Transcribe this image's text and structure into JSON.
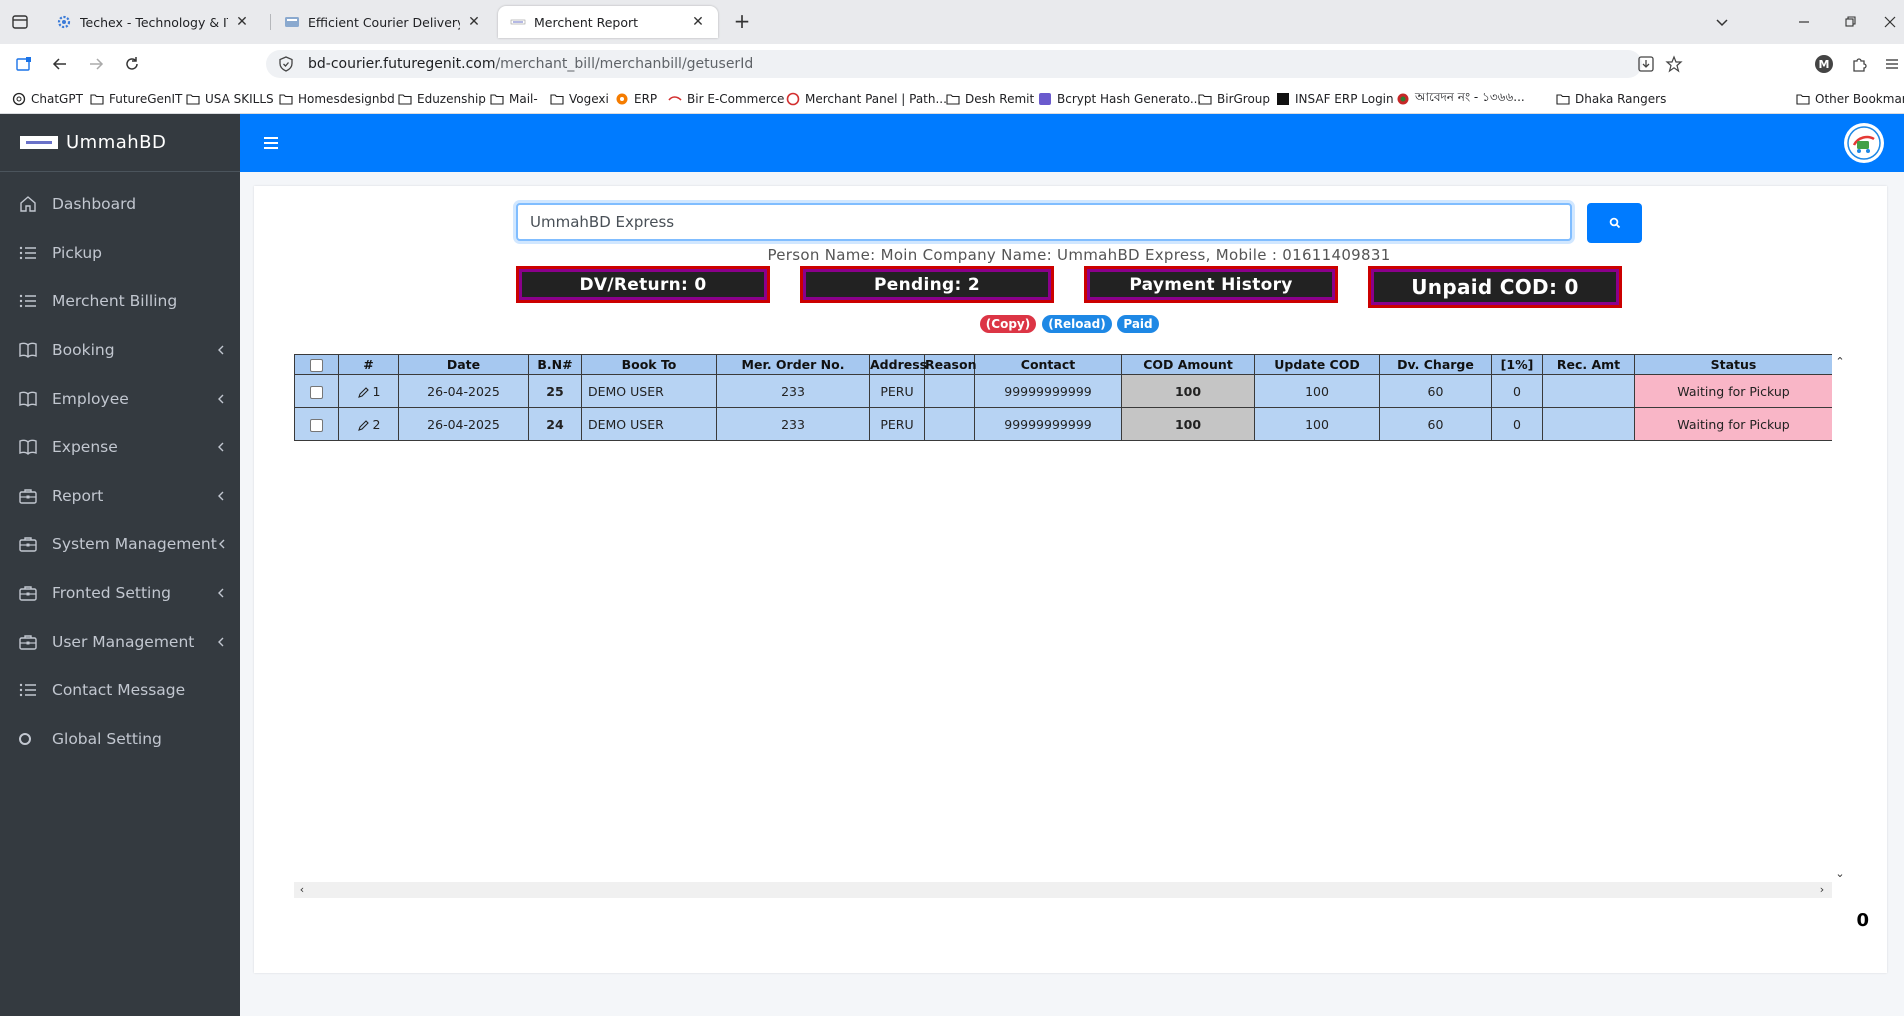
{
  "browser": {
    "tabs": [
      {
        "title": "Techex - Technology & IT Servic",
        "active": false
      },
      {
        "title": "Efficient Courier Delivery Manac",
        "active": false
      },
      {
        "title": "Merchent Report",
        "active": true
      }
    ],
    "url_host": "bd-courier.futuregenit.com",
    "url_path": "/merchant_bill/merchanbill/getuserId",
    "bookmarks": [
      "ChatGPT",
      "FutureGenIT",
      "USA SKILLS",
      "Homesdesignbd",
      "Eduzenship",
      "Mail-",
      "Vogexi",
      "ERP",
      "Bir E-Commerce",
      "Merchant Panel | Path...",
      "Desh Remit",
      "Bcrypt Hash Generato...",
      "BirGroup",
      "INSAF ERP Login",
      "আবেদন নং - ১৩৬৬...",
      "Dhaka Rangers"
    ],
    "other_bookmarks": "Other Bookmark",
    "profile_initial": "M"
  },
  "sidebar": {
    "brand": "UmmahBD",
    "items": [
      {
        "label": "Dashboard",
        "icon": "home-icon",
        "has_children": false
      },
      {
        "label": "Pickup",
        "icon": "list-icon",
        "has_children": false
      },
      {
        "label": "Merchent Billing",
        "icon": "list-icon",
        "has_children": false
      },
      {
        "label": "Booking",
        "icon": "book-icon",
        "has_children": true
      },
      {
        "label": "Employee",
        "icon": "book-icon",
        "has_children": true
      },
      {
        "label": "Expense",
        "icon": "book-icon",
        "has_children": true
      },
      {
        "label": "Report",
        "icon": "briefcase-icon",
        "has_children": true
      },
      {
        "label": "System Management",
        "icon": "briefcase-icon",
        "has_children": true
      },
      {
        "label": "Fronted Setting",
        "icon": "briefcase-icon",
        "has_children": true
      },
      {
        "label": "User Management",
        "icon": "briefcase-icon",
        "has_children": true
      },
      {
        "label": "Contact Message",
        "icon": "list-icon",
        "has_children": false
      },
      {
        "label": "Global Setting",
        "icon": "circle-icon",
        "has_children": false
      }
    ]
  },
  "search": {
    "value": "UmmahBD Express"
  },
  "person_info": "Person Name: Moin Company Name: UmmahBD Express, Mobile : 01611409831",
  "stats": {
    "dv_return": "DV/Return: 0",
    "pending": "Pending: 2",
    "payment_history": "Payment History",
    "unpaid_cod": "Unpaid COD: 0"
  },
  "actions": {
    "copy": "(Copy)",
    "reload": "(Reload)",
    "paid": "Paid"
  },
  "colors": {
    "primary": "#007bff",
    "sidebar_bg": "#343a40",
    "danger": "#dc3545",
    "status_bg": "#f9b6c7",
    "row_bg": "#b7d3f3"
  },
  "table": {
    "headers": [
      "#",
      "Date",
      "B.N#",
      "Book To",
      "Mer. Order No.",
      "Address",
      "Reason",
      "Contact",
      "COD Amount",
      "Update COD",
      "Dv. Charge",
      "[1%]",
      "Rec. Amt",
      "Status"
    ],
    "rows": [
      {
        "num": "1",
        "date": "26-04-2025",
        "bn": "25",
        "book_to": "DEMO USER",
        "order_no": "233",
        "address": "PERU",
        "reason": "",
        "contact": "99999999999",
        "cod": "100",
        "update_cod": "100",
        "dv_charge": "60",
        "one_pct": "0",
        "rec_amt": "",
        "status": "Waiting for Pickup"
      },
      {
        "num": "2",
        "date": "26-04-2025",
        "bn": "24",
        "book_to": "DEMO USER",
        "order_no": "233",
        "address": "PERU",
        "reason": "",
        "contact": "99999999999",
        "cod": "100",
        "update_cod": "100",
        "dv_charge": "60",
        "one_pct": "0",
        "rec_amt": "",
        "status": "Waiting for Pickup"
      }
    ]
  },
  "total": "0"
}
